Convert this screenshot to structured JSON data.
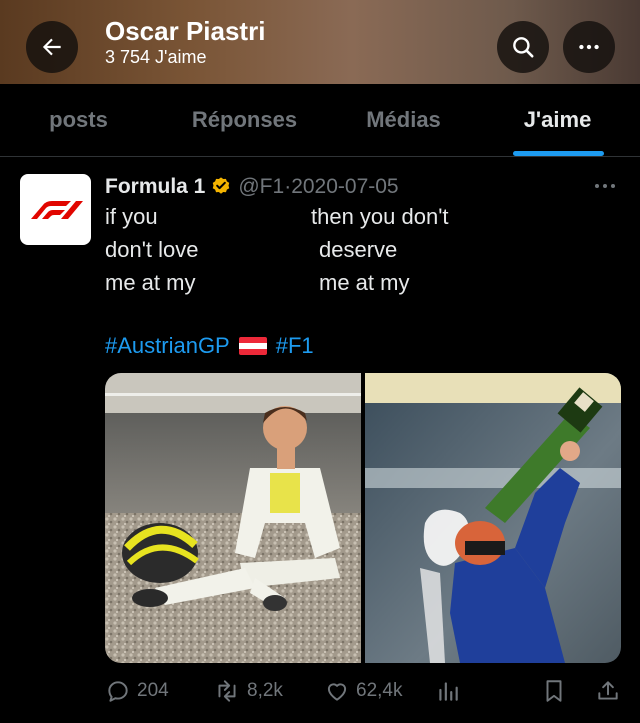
{
  "header": {
    "title": "Oscar Piastri",
    "subtitle": "3 754 J'aime",
    "back_icon": "arrow-left-icon",
    "search_icon": "search-icon",
    "more_icon": "more-horizontal-icon"
  },
  "tabs": [
    {
      "label": "posts",
      "active": false
    },
    {
      "label": "Réponses",
      "active": false
    },
    {
      "label": "Médias",
      "active": false
    },
    {
      "label": "J'aime",
      "active": true
    }
  ],
  "post": {
    "author": "Formula 1",
    "verified": true,
    "handle": "@F1",
    "separator": "·",
    "date": "2020-07-05",
    "text_left": [
      "if you",
      "don't love",
      "me at my"
    ],
    "text_right": [
      "then you don't",
      "deserve",
      "me at my"
    ],
    "hashtag_1": "#AustrianGP",
    "hashtag_2": "#F1",
    "images": [
      "driver-sitting-in-gravel-photo",
      "driver-drinking-champagne-photo"
    ],
    "stats": {
      "replies": "204",
      "reposts": "8,2k",
      "likes": "62,4k"
    }
  },
  "colors": {
    "accent": "#1d9bf0",
    "muted": "#71767b",
    "background": "#000000",
    "verified_badge": "#f4b400",
    "f1_red": "#e10600"
  }
}
